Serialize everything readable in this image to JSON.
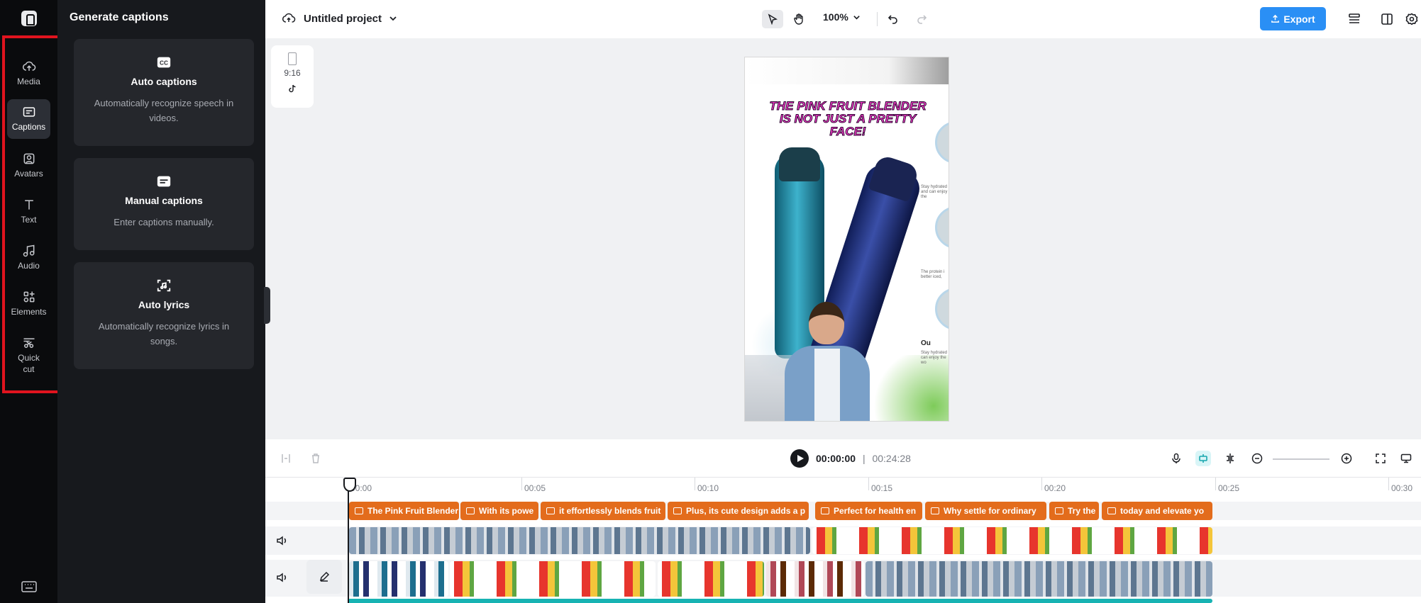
{
  "rail": {
    "items": [
      {
        "label": "Media",
        "icon": "cloud-upload-icon"
      },
      {
        "label": "Captions",
        "icon": "captions-icon",
        "active": true
      },
      {
        "label": "Avatars",
        "icon": "avatar-icon"
      },
      {
        "label": "Text",
        "icon": "text-icon"
      },
      {
        "label": "Audio",
        "icon": "music-note-icon"
      },
      {
        "label": "Elements",
        "icon": "shapes-icon"
      },
      {
        "label": "Quick cut",
        "icon": "scissors-icon"
      }
    ]
  },
  "panel": {
    "title": "Generate captions",
    "cards": [
      {
        "title": "Auto captions",
        "desc": "Automatically recognize speech in videos.",
        "icon": "cc-icon"
      },
      {
        "title": "Manual captions",
        "desc": "Enter captions manually.",
        "icon": "keyboard-icon"
      },
      {
        "title": "Auto lyrics",
        "desc": "Automatically recognize lyrics in songs.",
        "icon": "lyrics-scan-icon"
      }
    ]
  },
  "topbar": {
    "project_name": "Untitled project",
    "zoom": "100%",
    "export_label": "Export",
    "accent": "#2a8ff5"
  },
  "canvas": {
    "ratio_label": "9:16",
    "headline": "The Pink Fruit Blender is not just a pretty face!",
    "side_texts": [
      "Stay hydrated and can enjoy the",
      "The protein i better iced,",
      "Ou",
      "Stay hydrated or can enjoy the wo"
    ]
  },
  "playback": {
    "current": "00:00:00",
    "separator": "|",
    "total": "00:24:28"
  },
  "timeline": {
    "ticks": [
      "00:00",
      "00:05",
      "00:10",
      "00:15",
      "00:20",
      "00:25",
      "00:30"
    ],
    "caption_clips": [
      "The Pink Fruit Blender",
      "With its powe",
      "it effortlessly blends fruit",
      "Plus, its cute design adds a p",
      "Perfect for health en",
      "Why settle for ordinary",
      "Try the",
      "today and elevate yo"
    ],
    "caption_color": "#e36c1c",
    "playhead_color": "#17191d"
  }
}
